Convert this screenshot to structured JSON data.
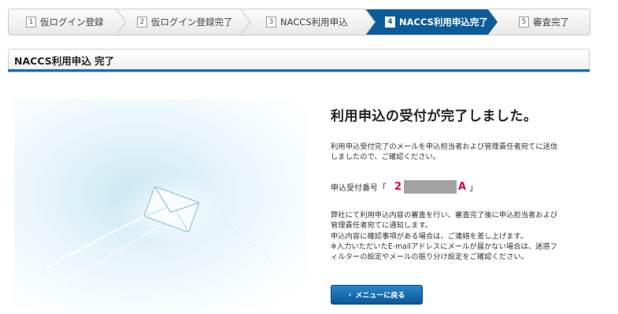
{
  "steps": [
    {
      "num": "1",
      "label": "仮ログイン登録"
    },
    {
      "num": "2",
      "label": "仮ログイン登録完了"
    },
    {
      "num": "3",
      "label": "NACCS利用申込"
    },
    {
      "num": "4",
      "label": "NACCS利用申込完了"
    },
    {
      "num": "5",
      "label": "審査完了"
    }
  ],
  "active_step_color": "#0d5c9a",
  "section": {
    "title": "NACCS利用申込 完了"
  },
  "main": {
    "heading": "利用申込の受付が完了しました。",
    "para1": "利用申込受付完了のメールを申込担当者および管理責任者宛てに送信しましたので、ご確認ください。",
    "receipt_label": "申込受付番号",
    "receipt_open": "「",
    "receipt_code_start": "2",
    "receipt_code_end": "A",
    "receipt_close": "」",
    "para2": "弊社にて利用申込内容の審査を行い、審査完了後に申込担当者および管理責任者宛てに通知します。\n申込内容に確認事項がある場合は、ご連絡を差し上げます。\n※入力いただいたE-mailアドレスにメールが届かない場合は、迷惑フィルターの設定やメールの振り分け設定をご確認ください。",
    "button_label": "メニューに戻る"
  },
  "icons": {
    "button_chevron": "chevron-left-icon",
    "envelope": "envelope-icon"
  }
}
